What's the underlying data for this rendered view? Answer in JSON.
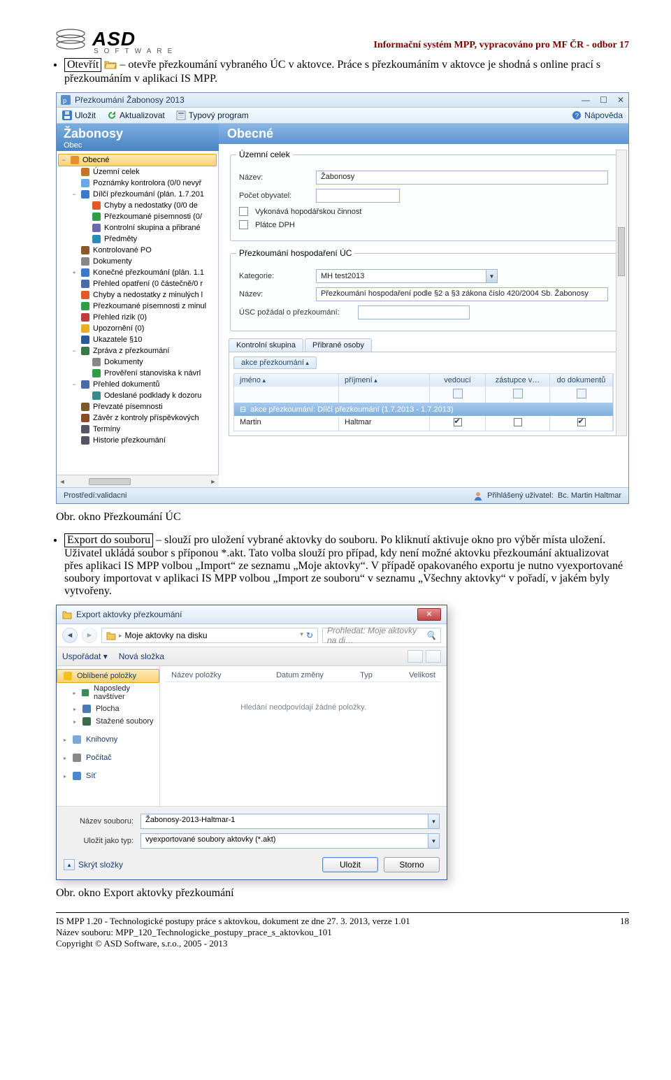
{
  "doc": {
    "header_right": "Informační systém MPP, vypracováno pro MF ČR - odbor 17",
    "logo_text": "ASD",
    "logo_sub": "SOFTWARE",
    "bullet1_box": "Otevřít",
    "bullet1_rest": " – otevře přezkoumání vybraného ÚC v aktovce. Práce s přezkoumáním v aktovce je shodná s online prací s přezkoumáním v aplikaci IS MPP.",
    "caption1": "Obr. okno Přezkoumání ÚC",
    "bullet2_box": "Export do souboru",
    "bullet2_rest": " – slouží pro uložení vybrané aktovky do souboru. Po kliknutí aktivuje okno pro výběr místa uložení. Uživatel ukládá soubor s příponou *.akt. Tato volba slouží pro případ, kdy není možné aktovku přezkoumání aktualizovat přes aplikaci IS MPP volbou „Import“ ze seznamu „Moje aktovky“. V případě opakovaného exportu je nutno vyexportované soubory importovat v aplikaci IS MPP volbou „Import ze souboru“ v seznamu „Všechny aktovky“ v pořadí, v jakém byly vytvořeny.",
    "caption2": "Obr. okno Export aktovky přezkoumání",
    "footer_l1": "IS MPP 1.20 - Technologické postupy práce s aktovkou, dokument ze dne 27. 3. 2013, verze 1.01",
    "footer_l2": "Název souboru: MPP_120_Technologicke_postupy_prace_s_aktovkou_101",
    "footer_l3": "Copyright © ASD Software, s.r.o., 2005 - 2013",
    "page_no": "18"
  },
  "win": {
    "title": "Přezkoumání Žabonosy 2013",
    "tb_ulozit": "Uložit",
    "tb_aktualizovat": "Aktualizovat",
    "tb_typovy": "Typový program",
    "tb_help": "Nápověda",
    "left_title": "Žabonosy",
    "left_sub": "Obec",
    "right_title": "Obecné",
    "fs1_legend": "Územní celek",
    "lbl_nazev": "Název:",
    "val_nazev": "Žabonosy",
    "lbl_pocet": "Počet obyvatel:",
    "chk_hosp": "Vykonává hopodářskou činnost",
    "chk_dph": "Plátce DPH",
    "fs2_legend": "Přezkoumání hospodaření ÚC",
    "lbl_kategorie": "Kategorie:",
    "val_kategorie": "MH test2013",
    "lbl_nazev2": "Název:",
    "val_nazev2": "Přezkoumání hospodaření podle §2 a §3 zákona číslo 420/2004 Sb. Žabonosy",
    "lbl_usc": "ÚSC požádal o přezkoumání:",
    "tab1": "Kontrolní skupina",
    "tab2": "Přibrané osoby",
    "sort_pill": "akce přezkoumání",
    "gh_jmeno": "jméno",
    "gh_prijmeni": "příjmení",
    "gh_vedouci": "vedoucí",
    "gh_zastupce": "zástupce v…",
    "gh_dok": "do dokumentů",
    "group_label": "akce přezkoumání: Dílčí přezkoumání (1.7.2013 - 1.7.2013)",
    "row_jmeno": "Martin",
    "row_prijmeni": "Haltmar",
    "status_env_l": "Prostředí: ",
    "status_env_v": "validacni",
    "status_user_l": "Přihlášený uživatel: ",
    "status_user_v": "Bc. Martin Haltmar"
  },
  "tree": [
    {
      "d": 1,
      "tw": "−",
      "ico": "home",
      "label": "Obecné",
      "sel": true
    },
    {
      "d": 2,
      "tw": "",
      "ico": "house",
      "label": "Územní celek"
    },
    {
      "d": 2,
      "tw": "",
      "ico": "note",
      "label": "Poznámky kontrolora (0/0 nevyř"
    },
    {
      "d": 2,
      "tw": "−",
      "ico": "cal",
      "label": "Dílčí přezkoumání (plán. 1.7.201"
    },
    {
      "d": 3,
      "tw": "",
      "ico": "warn",
      "label": "Chyby a nedostatky (0/0 de"
    },
    {
      "d": 3,
      "tw": "",
      "ico": "ok",
      "label": "Přezkoumané písemnosti (0/"
    },
    {
      "d": 3,
      "tw": "",
      "ico": "people",
      "label": "Kontrolní skupina a přibrané"
    },
    {
      "d": 3,
      "tw": "",
      "ico": "obj",
      "label": "Předměty"
    },
    {
      "d": 2,
      "tw": "",
      "ico": "org",
      "label": "Kontrolované PO"
    },
    {
      "d": 2,
      "tw": "",
      "ico": "doc",
      "label": "Dokumenty"
    },
    {
      "d": 2,
      "tw": "+",
      "ico": "cal",
      "label": "Konečné přezkoumání (plán. 1.1"
    },
    {
      "d": 2,
      "tw": "",
      "ico": "list",
      "label": "Přehled opatření (0 částečně/0 r"
    },
    {
      "d": 2,
      "tw": "",
      "ico": "warn",
      "label": "Chyby a nedostatky z minulých l"
    },
    {
      "d": 2,
      "tw": "",
      "ico": "ok",
      "label": "Přezkoumané písemnosti z minul"
    },
    {
      "d": 2,
      "tw": "",
      "ico": "risk",
      "label": "Přehled rizik (0)"
    },
    {
      "d": 2,
      "tw": "",
      "ico": "bell",
      "label": "Upozornění (0)"
    },
    {
      "d": 2,
      "tw": "",
      "ico": "para",
      "label": "Ukazatele §10"
    },
    {
      "d": 2,
      "tw": "−",
      "ico": "report",
      "label": "Zpráva z přezkoumání"
    },
    {
      "d": 3,
      "tw": "",
      "ico": "doc",
      "label": "Dokumenty"
    },
    {
      "d": 3,
      "tw": "",
      "ico": "check",
      "label": "Prověření stanoviska k návrl"
    },
    {
      "d": 2,
      "tw": "−",
      "ico": "list",
      "label": "Přehled dokumentů"
    },
    {
      "d": 3,
      "tw": "",
      "ico": "send",
      "label": "Odeslané podklady k dozoru"
    },
    {
      "d": 2,
      "tw": "",
      "ico": "recv",
      "label": "Převzaté písemnosti"
    },
    {
      "d": 2,
      "tw": "",
      "ico": "book",
      "label": "Závěr z kontroly příspěvkových"
    },
    {
      "d": 2,
      "tw": "",
      "ico": "clock",
      "label": "Termíny"
    },
    {
      "d": 2,
      "tw": "",
      "ico": "hist",
      "label": "Historie přezkoumání"
    }
  ],
  "dlg": {
    "title": "Export aktovky přezkoumání",
    "crumb": "Moje aktovky na disku",
    "search_ph": "Prohledat: Moje aktovky na di…",
    "tb_usporadat": "Uspořádat ▾",
    "tb_nova": "Nová složka",
    "fh_name": "Název položky",
    "fh_date": "Datum změny",
    "fh_type": "Typ",
    "fh_size": "Velikost",
    "empty": "Hledání neodpovídají žádné položky.",
    "lbl_filename": "Název souboru:",
    "val_filename": "Žabonosy-2013-Haltmar-1",
    "lbl_filetype": "Uložit jako typ:",
    "val_filetype": "vyexportované soubory aktovky (*.akt)",
    "hide": "Skrýt složky",
    "btn_save": "Uložit",
    "btn_cancel": "Storno"
  },
  "nav": [
    {
      "ico": "star",
      "label": "Oblíbené položky",
      "sel": true,
      "sub": false
    },
    {
      "ico": "recent",
      "label": "Naposledy navštíver",
      "sub": true
    },
    {
      "ico": "desk",
      "label": "Plocha",
      "sub": true
    },
    {
      "ico": "dl",
      "label": "Stažené soubory",
      "sub": true
    },
    {
      "sep": true
    },
    {
      "ico": "lib",
      "label": "Knihovny",
      "sub": false
    },
    {
      "sep": true
    },
    {
      "ico": "pc",
      "label": "Počítač",
      "sub": false
    },
    {
      "sep": true
    },
    {
      "ico": "net",
      "label": "Síť",
      "sub": false
    }
  ]
}
